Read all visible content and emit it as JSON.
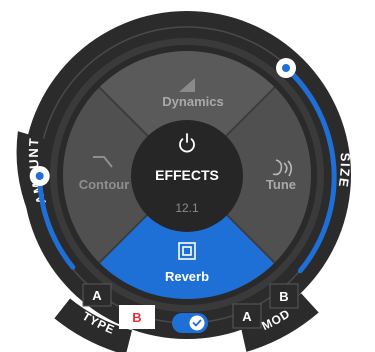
{
  "effects": {
    "title": "EFFECTS",
    "value": "12.1",
    "segments": {
      "dynamics": "Dynamics",
      "contour": "Contour",
      "tune": "Tune",
      "reverb": "Reverb"
    },
    "active_segment": "reverb"
  },
  "controls": {
    "amount_label": "AMOUNT",
    "size_label": "SIZE",
    "amount_level": 0.45,
    "size_level": 0.85
  },
  "type_selector": {
    "label": "TYPE",
    "option_a": "A",
    "option_b": "B",
    "selected": "B"
  },
  "mod_selector": {
    "label": "MOD",
    "option_a": "A",
    "option_b": "B"
  },
  "toggle": {
    "state": "on"
  },
  "colors": {
    "accent": "#1e6fd6",
    "panel_dark": "#2e2e2e",
    "segment": "#525252",
    "hub": "#262626",
    "selected_b": "#e2323c"
  }
}
